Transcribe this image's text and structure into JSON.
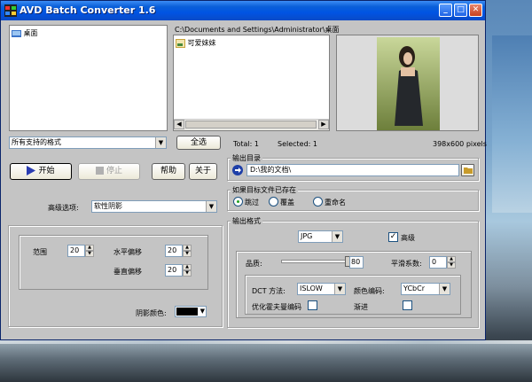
{
  "window": {
    "title": "AVD Batch Converter 1.6"
  },
  "folder_tree": {
    "items": [
      {
        "label": "桌面"
      }
    ]
  },
  "file_list": {
    "path": "C:\\Documents and Settings\\Administrator\\桌面",
    "items": [
      {
        "label": "可爱妹妹"
      }
    ]
  },
  "filter": {
    "value": "所有支持的格式",
    "select_all_label": "全选"
  },
  "status": {
    "total": "Total: 1",
    "selected": "Selected: 1",
    "dimensions": "398x600 pixels"
  },
  "actions": {
    "start": "开始",
    "stop": "停止",
    "help": "帮助",
    "about": "关于"
  },
  "advanced": {
    "label": "高级选项:",
    "value": "软性阴影"
  },
  "shadow": {
    "range_label": "范围",
    "range_value": "20",
    "hoffset_label": "水平偏移",
    "hoffset_value": "20",
    "voffset_label": "垂直偏移",
    "voffset_value": "20",
    "color_label": "阴影颜色:",
    "color": "#000000"
  },
  "output_dir": {
    "group_label": "输出目录",
    "value": "D:\\我的文档\\"
  },
  "exists": {
    "group_label": "如果目标文件已存在",
    "options": [
      "跳过",
      "覆盖",
      "重命名"
    ],
    "selected": 0
  },
  "format": {
    "group_label": "输出格式",
    "value": "JPG",
    "advanced_label": "高级",
    "advanced_checked": true,
    "quality_label": "品质:",
    "quality_value": "80",
    "smooth_label": "平滑系数:",
    "smooth_value": "0",
    "dct_label": "DCT 方法:",
    "dct_value": "ISLOW",
    "color_enc_label": "颜色编码:",
    "color_enc_value": "YCbCr",
    "huffman_label": "优化霍夫曼编码",
    "progressive_label": "渐进"
  },
  "colors": {
    "titlebar": "#0054e3",
    "window_bg": "#c4c4c4",
    "link_arrow": "#1e3fa8"
  }
}
